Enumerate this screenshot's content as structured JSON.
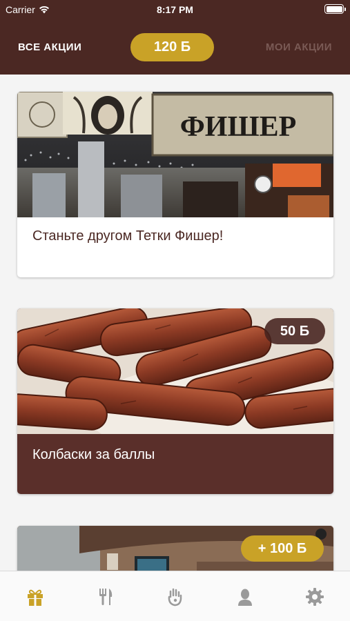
{
  "status_bar": {
    "carrier": "Carrier",
    "time": "8:17 PM"
  },
  "header": {
    "tab_all": "ВСЕ АКЦИИ",
    "points": "120 Б",
    "tab_mine": "МОИ АКЦИИ"
  },
  "cards": [
    {
      "title": "Станьте другом Тетки Фишер!",
      "sign_text": "ФИШЕР"
    },
    {
      "title": "Колбаски за баллы",
      "badge": "50 Б"
    },
    {
      "badge": "+ 100 Б"
    }
  ],
  "tabbar": {
    "items": [
      {
        "icon": "gift-icon",
        "active": true
      },
      {
        "icon": "fork-knife-icon",
        "active": false
      },
      {
        "icon": "hand-icon",
        "active": false
      },
      {
        "icon": "profile-icon",
        "active": false
      },
      {
        "icon": "gear-icon",
        "active": false
      }
    ]
  },
  "colors": {
    "header_bg": "#4b2823",
    "accent": "#c9a227",
    "active_icon": "#c9a227",
    "inactive_icon": "#9a9a9a"
  }
}
